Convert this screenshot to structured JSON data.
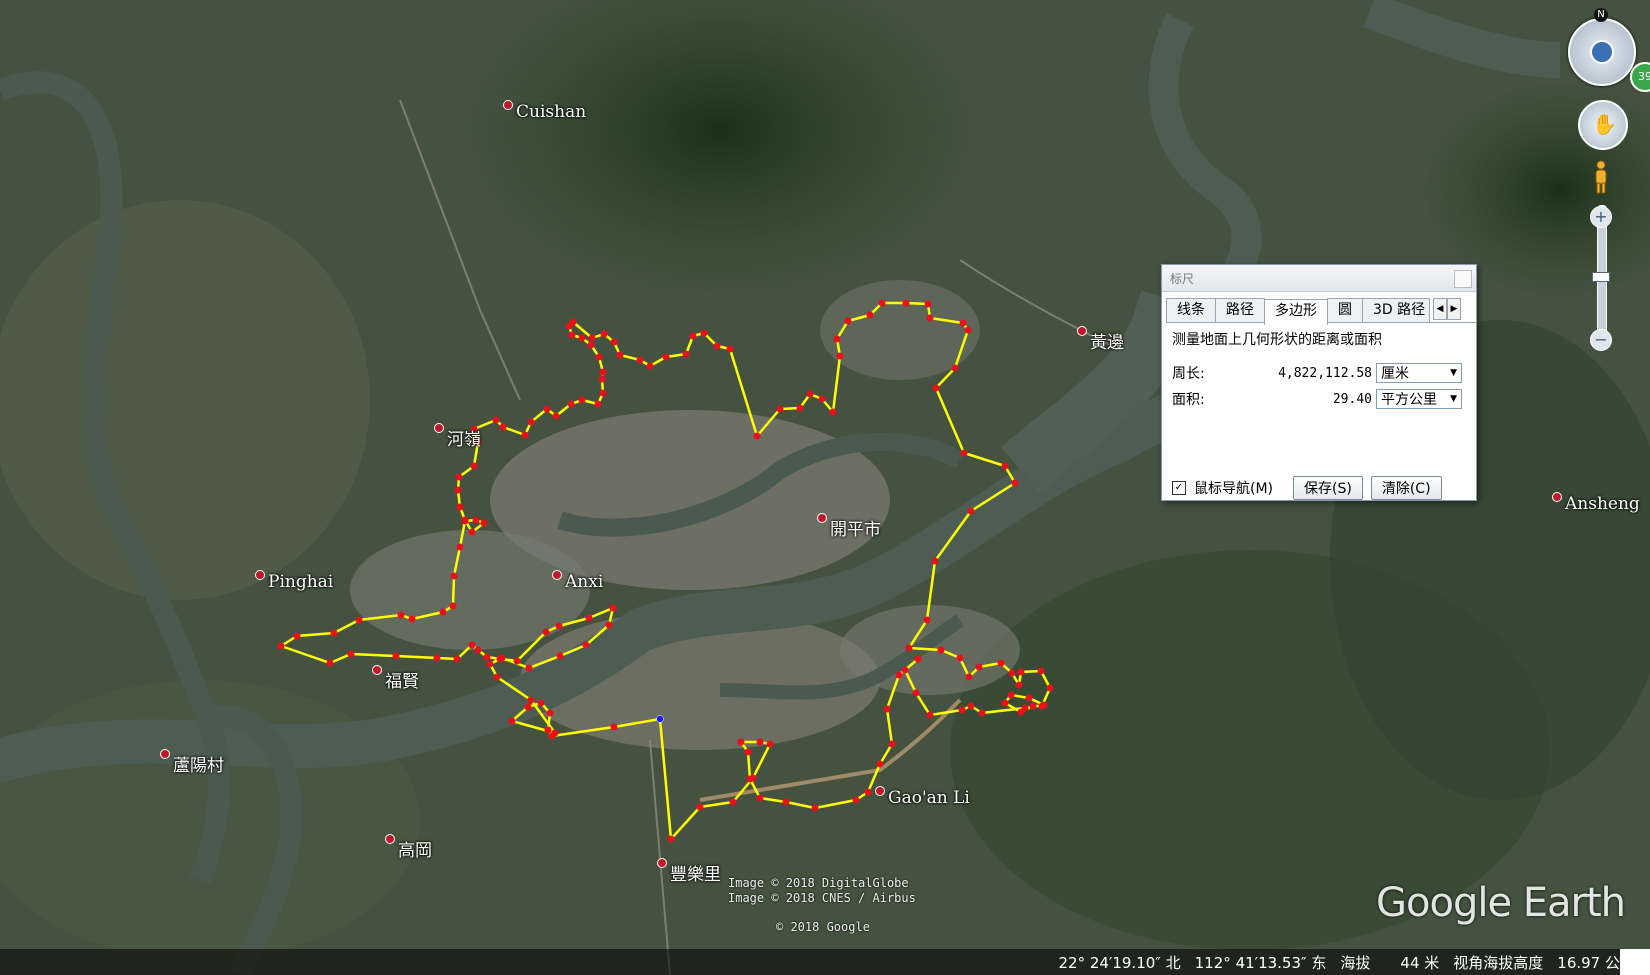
{
  "places": [
    {
      "id": "cuishan",
      "label": "Cuishan"
    },
    {
      "id": "heling",
      "label": "河嶺"
    },
    {
      "id": "pinghai",
      "label": "Pinghai"
    },
    {
      "id": "anxi",
      "label": "Anxi"
    },
    {
      "id": "fuxian",
      "label": "福賢"
    },
    {
      "id": "kaiping",
      "label": "開平市"
    },
    {
      "id": "huangbian",
      "label": "黃邊"
    },
    {
      "id": "ansheng",
      "label": "Ansheng"
    },
    {
      "id": "luyang",
      "label": "蘆陽村"
    },
    {
      "id": "gaogang",
      "label": "高岡"
    },
    {
      "id": "gaoanli",
      "label": "Gao'an Li"
    },
    {
      "id": "fengleli",
      "label": "豐樂里"
    }
  ],
  "credits": [
    "Image © 2018 DigitalGlobe",
    "Image © 2018 CNES / Airbus",
    "© 2018 Google"
  ],
  "logo": "Google Earth",
  "status": {
    "lat": "22° 24′19.10″ 北",
    "lon": "112° 41′13.53″ 东",
    "elev_label": "海拔",
    "elev_value": "44 米",
    "eye_label": "视角海拔高度",
    "eye_value": "16.97 公"
  },
  "nav": {
    "north": "N",
    "badge": "39"
  },
  "ruler": {
    "title": "标尺",
    "tabs": [
      "线条",
      "路径",
      "多边形",
      "圆",
      "3D 路径"
    ],
    "active_tab": "多边形",
    "description": "测量地面上几何形状的距离或面积",
    "perimeter_label": "周长:",
    "perimeter_value": "4,822,112.58",
    "perimeter_unit": "厘米",
    "area_label": "面积:",
    "area_value": "29.40",
    "area_unit": "平方公里",
    "mouse_nav_label": "鼠标导航(M)",
    "mouse_nav_checked": true,
    "save_label": "保存(S)",
    "clear_label": "清除(C)"
  },
  "colors": {
    "polygon": "#ffff00",
    "vertex": "#e8101a",
    "river": "#4f5f55",
    "land": "#3f4a3a"
  }
}
